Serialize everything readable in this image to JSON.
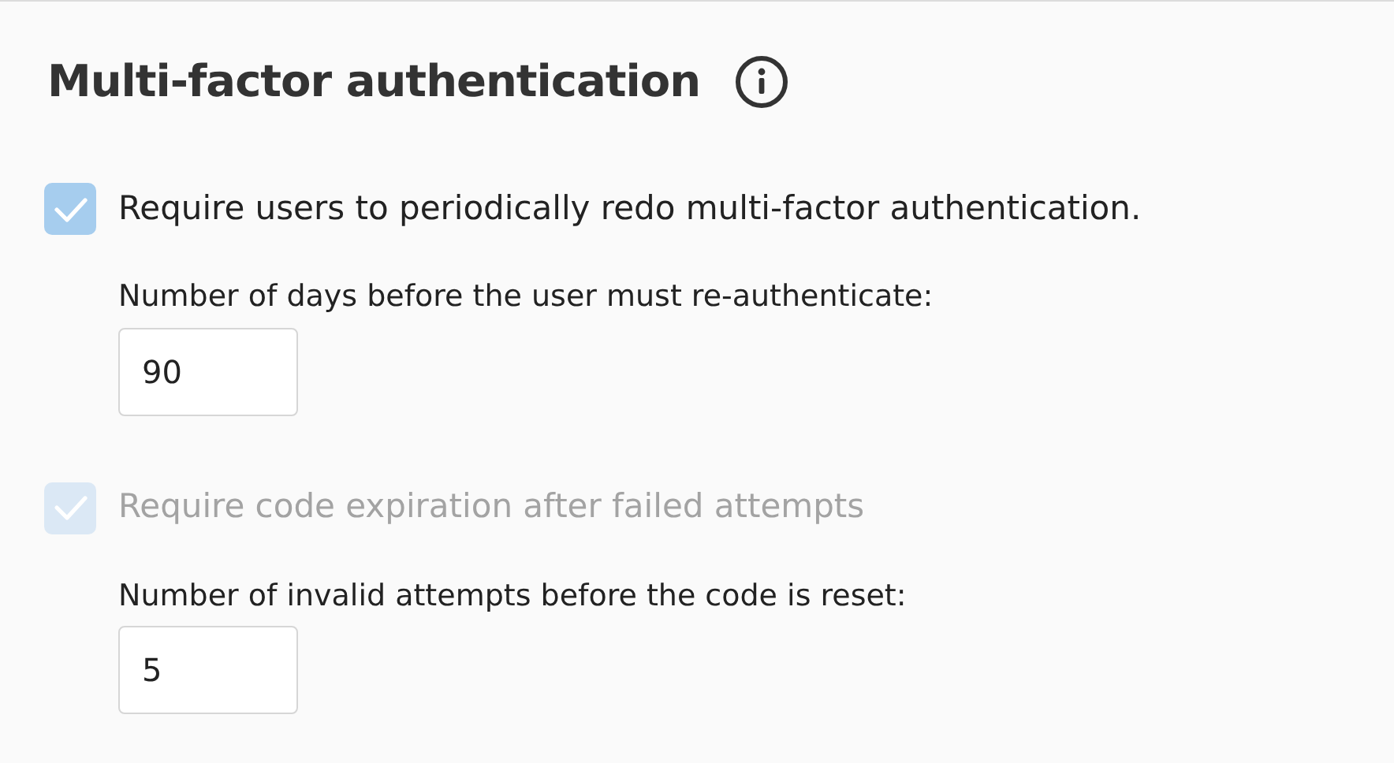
{
  "section": {
    "title": "Multi-factor authentication"
  },
  "options": [
    {
      "label": "Require users to periodically redo multi-factor authentication.",
      "checked": true,
      "disabled": false,
      "field_label": "Number of days before the user must re-authenticate:",
      "value": "90"
    },
    {
      "label": "Require code expiration after failed attempts",
      "checked": true,
      "disabled": true,
      "field_label": "Number of invalid attempts before the code is reset:",
      "value": "5"
    }
  ]
}
